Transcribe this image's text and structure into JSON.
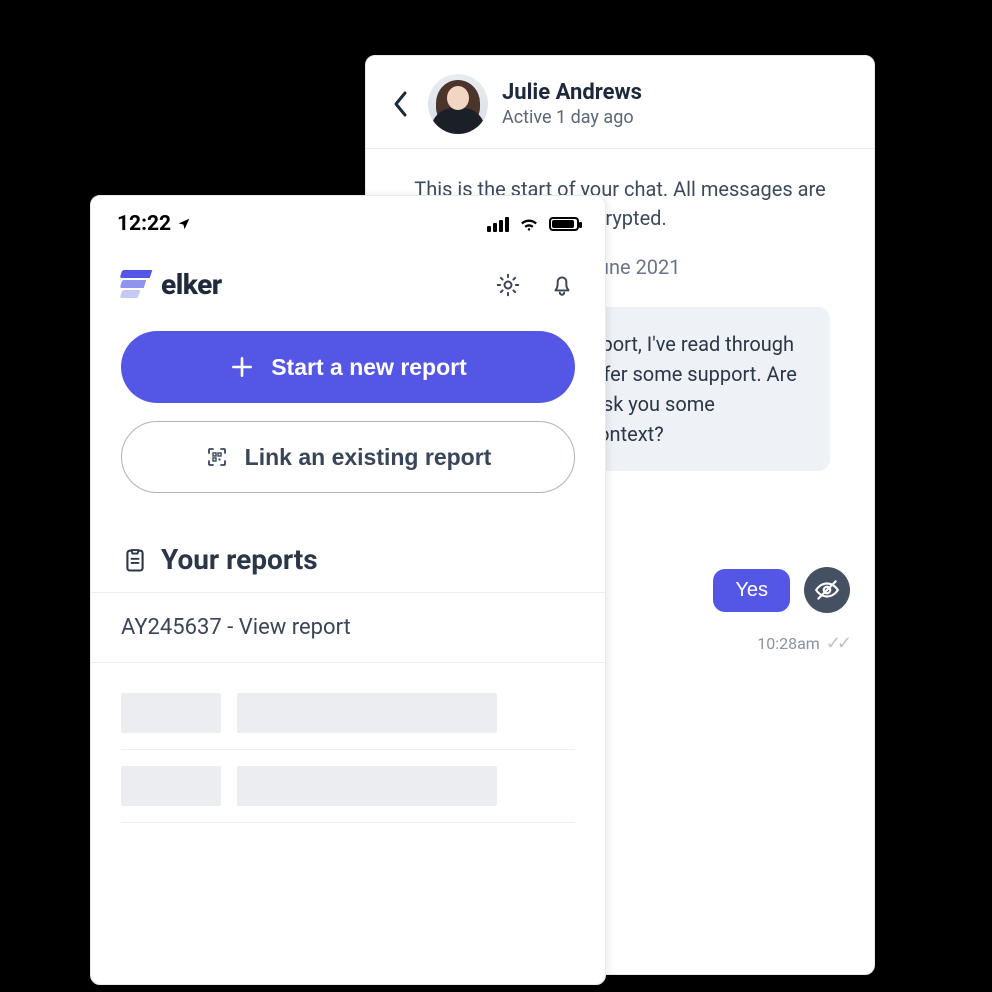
{
  "chat": {
    "name": "Julie Andrews",
    "status": "Active 1 day ago",
    "intro": "This is the start of your chat. All messages are encrypted.",
    "date": "16 June 2021",
    "message": "Thank you for your report, I've read through it and would like to offer some support. Are you comfortable if I ask you some questions for more context?",
    "reply_yes": "Yes",
    "time": "10:28am"
  },
  "statusbar": {
    "time": "12:22"
  },
  "brand": {
    "name": "elker"
  },
  "actions": {
    "new_report": "Start a new report",
    "link_report": "Link an existing report"
  },
  "reports": {
    "section_title": "Your reports",
    "item_label": "AY245637 - View report"
  }
}
